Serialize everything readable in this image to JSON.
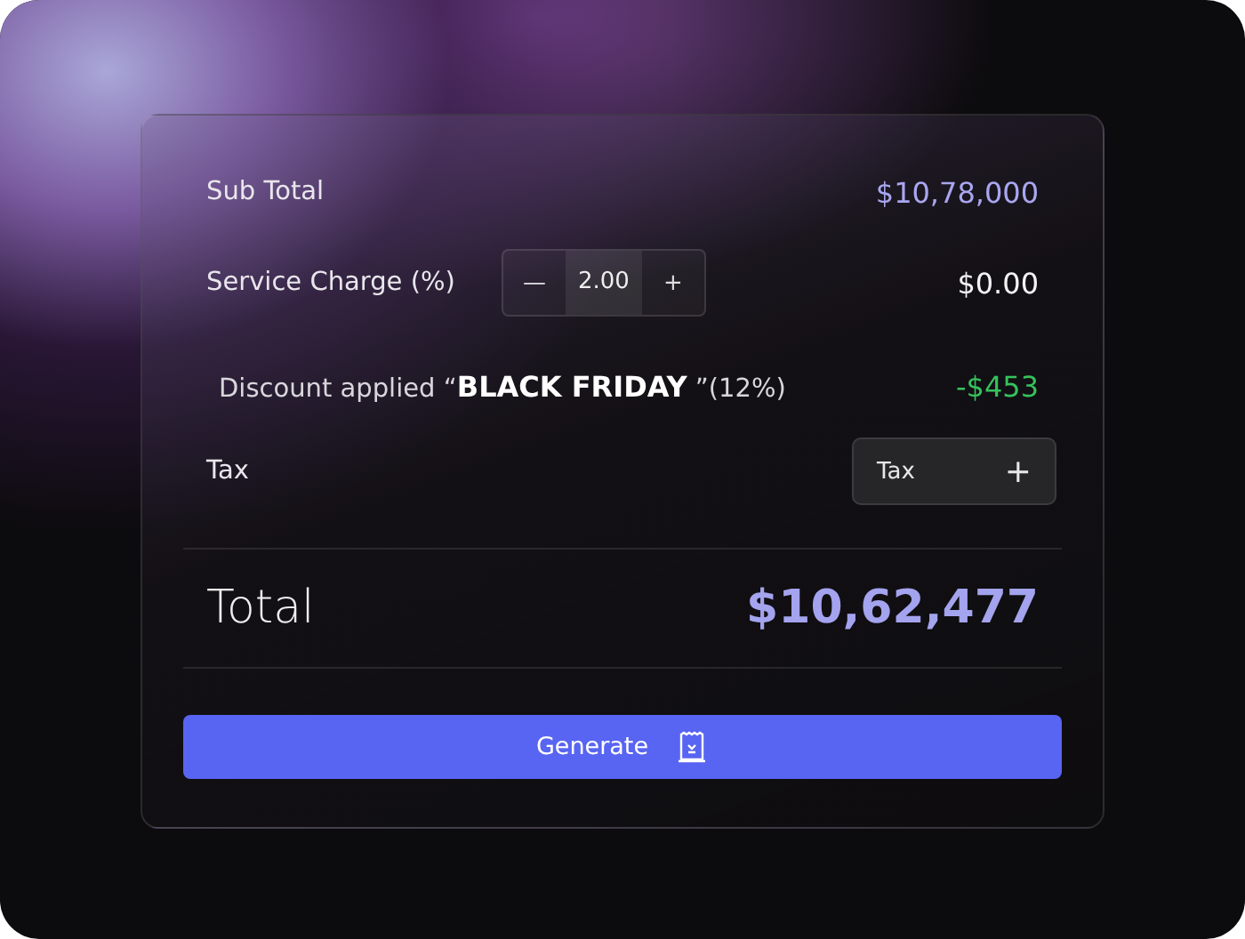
{
  "rows": [
    {
      "kind": "amount",
      "label": "Sub Total",
      "value": "$10,78,000",
      "color": "#a9a6f0"
    },
    {
      "kind": "stepper",
      "label": "Service Charge (%)",
      "minus": "—",
      "amount": "2.00",
      "plus": "+",
      "value": "$0.00",
      "color": "#f2f2f2"
    },
    {
      "kind": "discount",
      "label": "Discount applied “**BLACK FRIDAY** ”(12%)",
      "value": "-$453",
      "color": "#36c25c"
    },
    {
      "kind": "add",
      "label": "Tax",
      "button_label": "Tax",
      "plus": "+"
    }
  ],
  "total": {
    "label": "Total",
    "value": "$10,62,477"
  },
  "action": {
    "label": "Generate"
  }
}
